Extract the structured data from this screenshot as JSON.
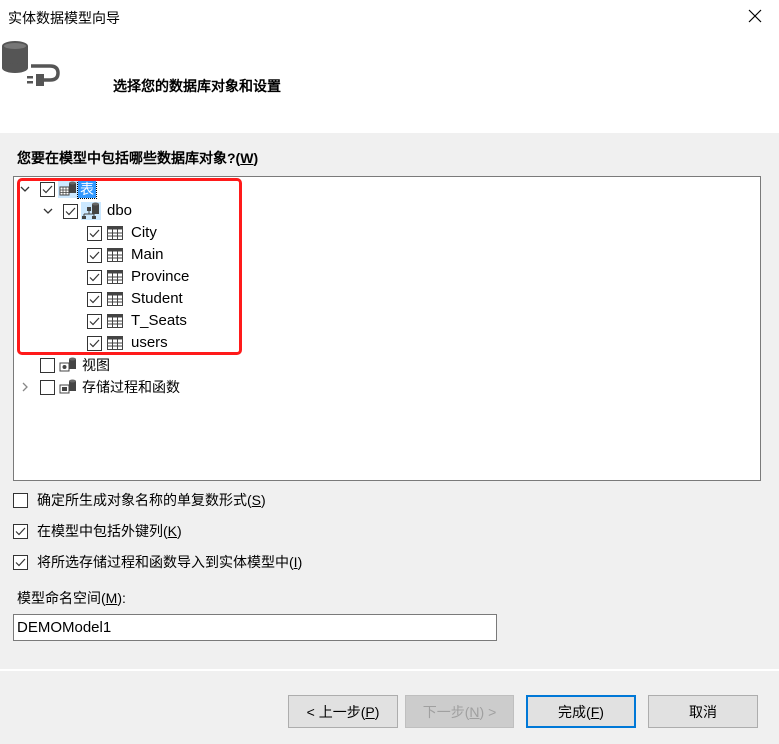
{
  "window": {
    "title": "实体数据模型向导",
    "close_icon": "close-icon"
  },
  "header": {
    "icon": "database-plug-icon",
    "subtitle": "选择您的数据库对象和设置"
  },
  "question": {
    "text": "您要在模型中包括哪些数据库对象?(",
    "accel": "W",
    "suffix": ")"
  },
  "tree": {
    "tables": {
      "label": "表",
      "checked": true,
      "expanded": true,
      "selected": true,
      "icon": "tables-folder-icon",
      "schema": {
        "label": "dbo",
        "checked": true,
        "expanded": true,
        "icon": "schema-icon",
        "items": [
          {
            "label": "City",
            "checked": true,
            "icon": "table-icon"
          },
          {
            "label": "Main",
            "checked": true,
            "icon": "table-icon"
          },
          {
            "label": "Province",
            "checked": true,
            "icon": "table-icon"
          },
          {
            "label": "Student",
            "checked": true,
            "icon": "table-icon"
          },
          {
            "label": "T_Seats",
            "checked": true,
            "icon": "table-icon"
          },
          {
            "label": "users",
            "checked": true,
            "icon": "table-icon"
          }
        ]
      }
    },
    "views": {
      "label": "视图",
      "checked": false,
      "icon": "views-folder-icon"
    },
    "procedures": {
      "label": "存储过程和函数",
      "checked": false,
      "expanded": false,
      "icon": "procedures-folder-icon"
    }
  },
  "highlight_color": "#ff1a1a",
  "options": [
    {
      "text": "确定所生成对象名称的单复数形式(",
      "accel": "S",
      "suffix": ")",
      "checked": false
    },
    {
      "text": "在模型中包括外键列(",
      "accel": "K",
      "suffix": ")",
      "checked": true
    },
    {
      "text": "将所选存储过程和函数导入到实体模型中(",
      "accel": "I",
      "suffix": ")",
      "checked": true
    }
  ],
  "namespace": {
    "label": "模型命名空间(",
    "accel": "M",
    "suffix": "):",
    "value": "DEMOModel1"
  },
  "buttons": {
    "back": {
      "pre": "< 上一步(",
      "accel": "P",
      "post": ")"
    },
    "next": {
      "pre": "下一步(",
      "accel": "N",
      "post": ") >",
      "disabled": true
    },
    "finish": {
      "pre": "完成(",
      "accel": "F",
      "post": ")"
    },
    "cancel": {
      "label": "取消"
    }
  },
  "colors": {
    "accent": "#0078d7",
    "selection": "#3399ff",
    "background": "#f0f0f0"
  }
}
